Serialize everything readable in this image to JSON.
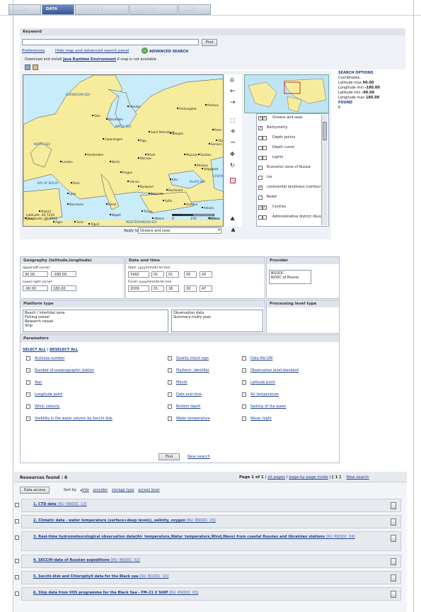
{
  "tabs": [
    "HOME",
    "DATA",
    "PROVIDERS",
    "SERVICES",
    "MAPS"
  ],
  "keyword": {
    "section_label": "Keyword",
    "value": "",
    "find": "Find"
  },
  "links": {
    "preferences": "Preferences",
    "hide_map": "Hide map and advanced search panel",
    "advanced_search": "ADVANCED SEARCH",
    "java_prefix": "Download and install",
    "java_link": "Java Runtime Environment",
    "java_suffix": "if map is not available"
  },
  "map": {
    "labels": [
      "NORWEGIAN SEA",
      "NORTH SEA",
      "BALTIC SEA",
      "Saint Petersburg",
      "Moscow",
      "Kiev",
      "Warsaw",
      "Berlin",
      "Paris",
      "London",
      "Lyon",
      "Sofia",
      "Ankara",
      "Istanbul",
      "BLACK SEA",
      "CASPIAN",
      "BAY OF BISCAY",
      "Madrid",
      "Barcelona",
      "Rome",
      "Napoli",
      "Tirana",
      "Minsk",
      "Riga",
      "Helsinki",
      "Oslo",
      "Stockholm",
      "Copenhagen",
      "Amsterdam",
      "Prague",
      "Vienna",
      "Budapest",
      "Belgrade",
      "Bucharest",
      "Athens",
      "Izmir",
      "Adana",
      "MEDITERRANEAN SEA",
      "Tripoli",
      "Alger",
      "Tunis",
      "Oran",
      "Kharkov",
      "Samara",
      "Saratov",
      "Volgograd",
      "Ufa",
      "Perm",
      "Pechora",
      "Arkhangelsk",
      "Vologda"
    ],
    "coords": [
      "Latitude: 40.7216",
      "Longitude: 40.9964"
    ],
    "scale": [
      "0",
      "370",
      "740 km"
    ]
  },
  "apply_to": {
    "label": "Apply to",
    "value": "Oceans and seas"
  },
  "layers": [
    {
      "label": "Oceans and seas",
      "checked": true,
      "double": true
    },
    {
      "label": "Bathymetry",
      "checked": true,
      "double": false
    },
    {
      "label": "Depth points",
      "checked": false,
      "double": true
    },
    {
      "label": "Depth curve",
      "checked": false,
      "double": true
    },
    {
      "label": "Lights",
      "checked": false,
      "double": true
    },
    {
      "label": "Economic zone of Russia",
      "checked": false,
      "double": false
    },
    {
      "label": "Ice",
      "checked": false,
      "double": false
    },
    {
      "label": "continental landmass (contour)",
      "checked": true,
      "double": false
    },
    {
      "label": "Relief",
      "checked": false,
      "double": false
    },
    {
      "label": "Centres",
      "checked": true,
      "double": true
    },
    {
      "label": "Administrative district (Russia)",
      "checked": false,
      "double": true
    }
  ],
  "search_options": {
    "title": "SEARCH OPTIONS",
    "coords_label": "Coordinates:",
    "lat_max": "Latitude max",
    "lat_max_v": "90.00",
    "lon_min": "Longitude min",
    "lon_min_v": "-180.00",
    "lat_min": "Latitude min",
    "lat_min_v": "-90.00",
    "lon_max": "Longitude max",
    "lon_max_v": "180.00",
    "found": "FOUND",
    "found_v": "6"
  },
  "geography": {
    "title": "Geography (latitude,longitude)",
    "upper_left": "Upper-left corner:",
    "ul_lat": "90.00",
    "ul_lon": "-180.00",
    "lower_right": "Lower-right corner:",
    "lr_lat": "-90.00",
    "lr_lon": "180.00"
  },
  "datetime": {
    "title": "Date and time",
    "start": "Start: yyyy/mm/dd hh:mm",
    "s_y": "1992",
    "s_m": "01",
    "s_d": "01",
    "s_h": "00",
    "s_mi": "00",
    "finish": "Finish: yyyy/mm/dd hh:mm",
    "f_y": "2009",
    "f_m": "01",
    "f_d": "26",
    "f_h": "20",
    "f_mi": "47"
  },
  "provider": {
    "title": "Provider",
    "items": [
      "BGODC",
      "NODC of Russia"
    ]
  },
  "platform": {
    "title": "Platform type",
    "items": [
      "Beach / intertidal zone",
      "Fishing vessel",
      "Research vessel",
      "Ship"
    ]
  },
  "obs": {
    "items": [
      "Observation data",
      "Summary-multy-year"
    ]
  },
  "processing": {
    "title": "Processing level type"
  },
  "parameters": {
    "title": "Parameters",
    "select_all": "SELECT ALL",
    "deselect_all": "DESELECT ALL",
    "col1": [
      "Archives number",
      "Number of oceanographic station",
      "Year",
      "Longitude point",
      "Wind: velocity",
      "Visibility in the water column by Secchi disk"
    ],
    "col2": [
      "Quality check sign",
      "Platform: identifier",
      "Month",
      "Date and time",
      "Bottom depth",
      "Water temperature"
    ],
    "col3": [
      "Data file:URI",
      "Observation level:standard",
      "Latitude point",
      "Air temperature",
      "Salinity of the water",
      "Wave: hight"
    ],
    "find": "Find",
    "new_search": "New search"
  },
  "results": {
    "found": "Resources found : 6",
    "page": "Page 1 of 1",
    "all_pages": "all pages",
    "page_mode": "page-by-page mode",
    "current": "[ 1 ]",
    "new_search": "New search",
    "data_access": "Data access",
    "sort_by": "Sort by",
    "sort_opts": [
      "title",
      "provider",
      "storage type",
      "access level"
    ]
  },
  "rows": [
    {
      "title": "1.  CTD data",
      "src": "[RU_RNODC_13]"
    },
    {
      "title": "2.  Climatic data - water temperature (surface+deep levels), salinity, oxygen",
      "src": "[RU_RNODC_03]"
    },
    {
      "title": "3.  Real-time hydrometeorological observation data(Air_temperature,Water_temperature,Wind,Wave) from coastal Russian and Ukrainian stations",
      "src": "[RU_RNODC_04]"
    },
    {
      "title": "4.  SECCHI-data of Russian expeditions",
      "src": "[RU_RNODC_02]"
    },
    {
      "title": "5.  Secchi disk and Chlorophyll data for the Black sea",
      "src": "[RU_BGODC_10]"
    },
    {
      "title": "6.  Ship data from VOS programme for the Black Sea - FM-21 V SHIP",
      "src": "[RU_RNODC_03]"
    }
  ]
}
